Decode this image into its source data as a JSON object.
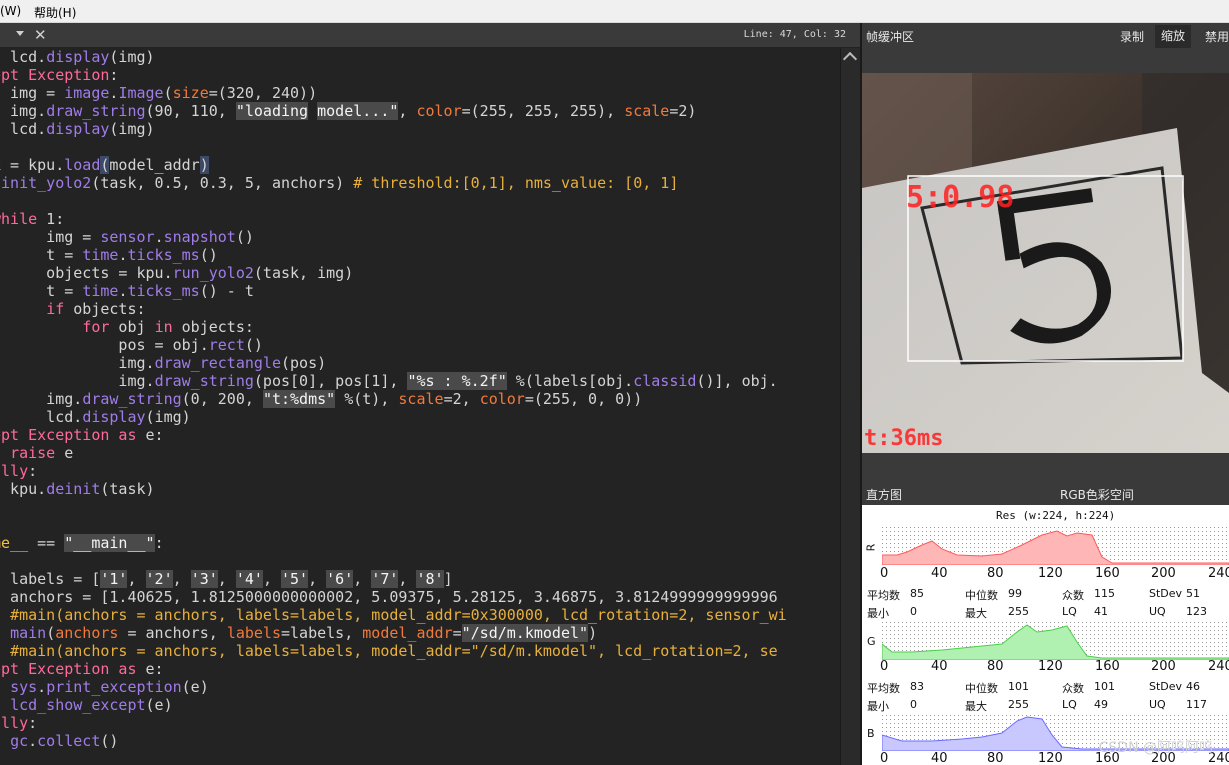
{
  "menu": {
    "items": [
      "(W)",
      "帮助(H)"
    ]
  },
  "editor": {
    "cursor_position": "Line: 47, Col: 32"
  },
  "framebuffer": {
    "title": "帧缓冲区",
    "buttons": [
      "录制",
      "缩放",
      "禁用"
    ],
    "detection_label": "5:0.98",
    "time_label": "t:36ms"
  },
  "histogram": {
    "title": "直方图",
    "colorspace": "RGB色彩空间",
    "resolution": "Res (w:224, h:224)",
    "ticks": [
      "0",
      "40",
      "80",
      "120",
      "160",
      "200",
      "240"
    ],
    "channels": [
      {
        "name": "R",
        "color": "#ff9d9d",
        "stats_row1": [
          "平均数",
          "85",
          "中位数",
          "99",
          "众数",
          "115",
          "StDev",
          "51"
        ],
        "stats_row2": [
          "最小",
          "0",
          "最大",
          "255",
          "LQ",
          "41",
          "UQ",
          "123"
        ]
      },
      {
        "name": "G",
        "color": "#9df29d",
        "stats_row1": [
          "平均数",
          "83",
          "中位数",
          "101",
          "众数",
          "101",
          "StDev",
          "46"
        ],
        "stats_row2": [
          "最小",
          "0",
          "最大",
          "255",
          "LQ",
          "49",
          "UQ",
          "117"
        ]
      },
      {
        "name": "B",
        "color": "#b0b0ff"
      }
    ]
  },
  "watermark": "CSDN @阿呜阿呜",
  "colors": {
    "keyword": "#ff6a9a",
    "function": "#a07ce8",
    "param": "#f07a3c",
    "comment": "#e8b03a"
  }
}
